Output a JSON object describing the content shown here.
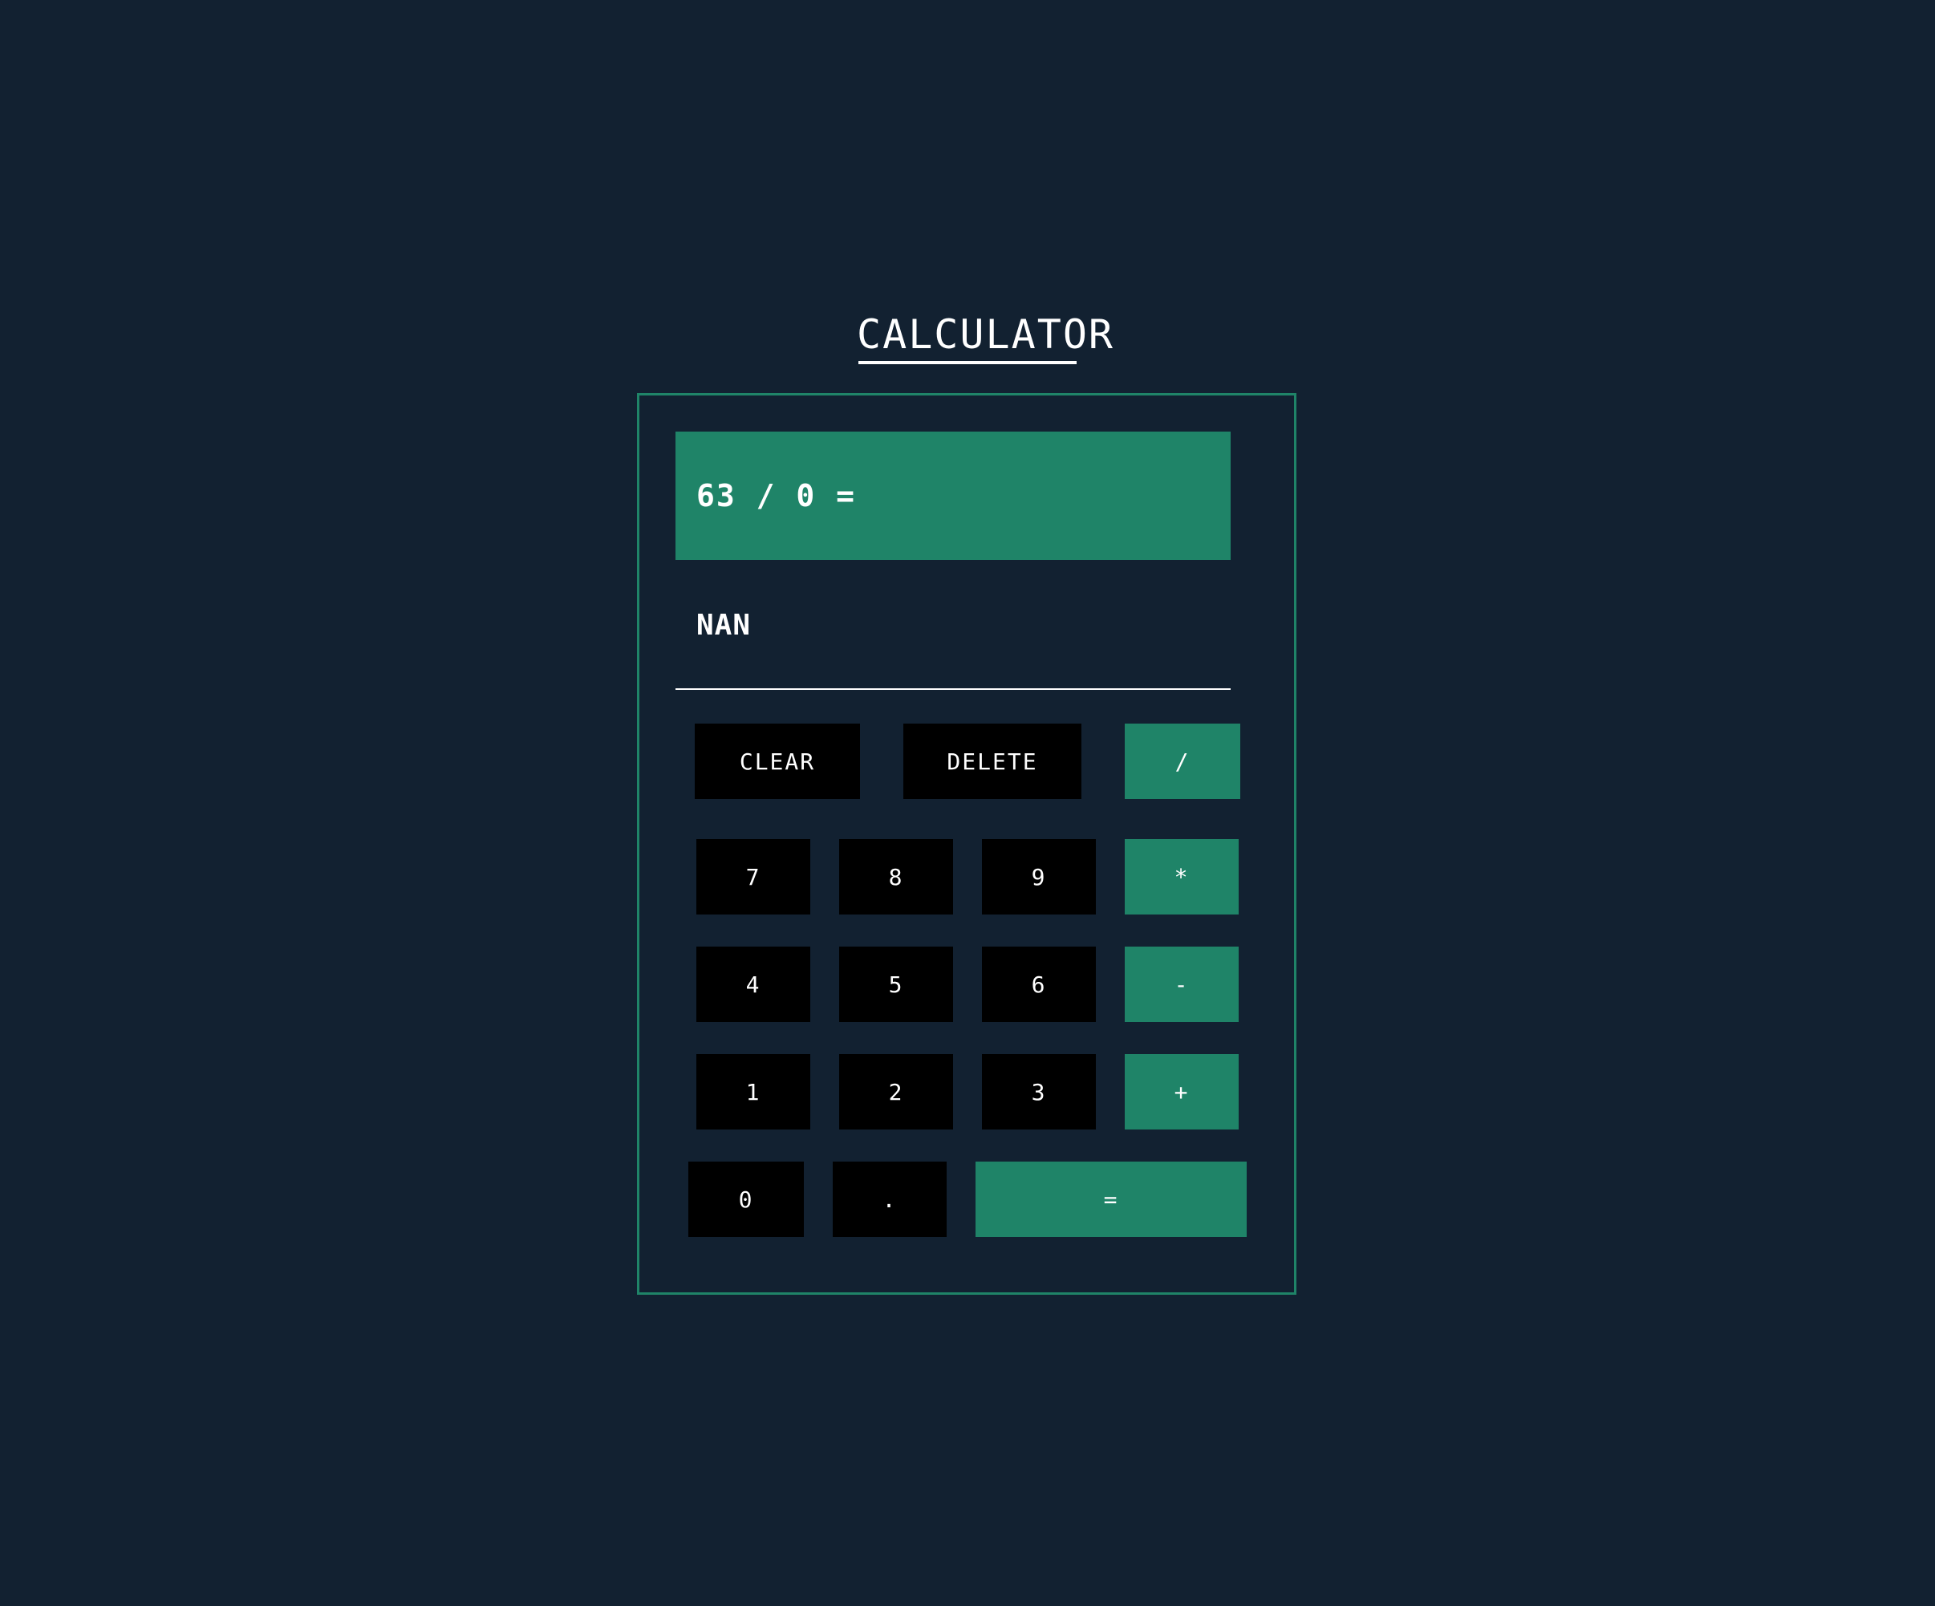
{
  "title": "CALCULATOR",
  "display": {
    "previous": "63 / 0 =",
    "current": "NAN"
  },
  "keys": {
    "clear": "CLEAR",
    "delete": "DELETE",
    "divide": "/",
    "seven": "7",
    "eight": "8",
    "nine": "9",
    "multiply": "*",
    "four": "4",
    "five": "5",
    "six": "6",
    "minus": "-",
    "one": "1",
    "two": "2",
    "three": "3",
    "plus": "+",
    "zero": "0",
    "dot": ".",
    "equals": "="
  },
  "colors": {
    "background": "#122131",
    "accent": "#1f8468",
    "key_dark": "#000000",
    "text": "#ffffff"
  }
}
